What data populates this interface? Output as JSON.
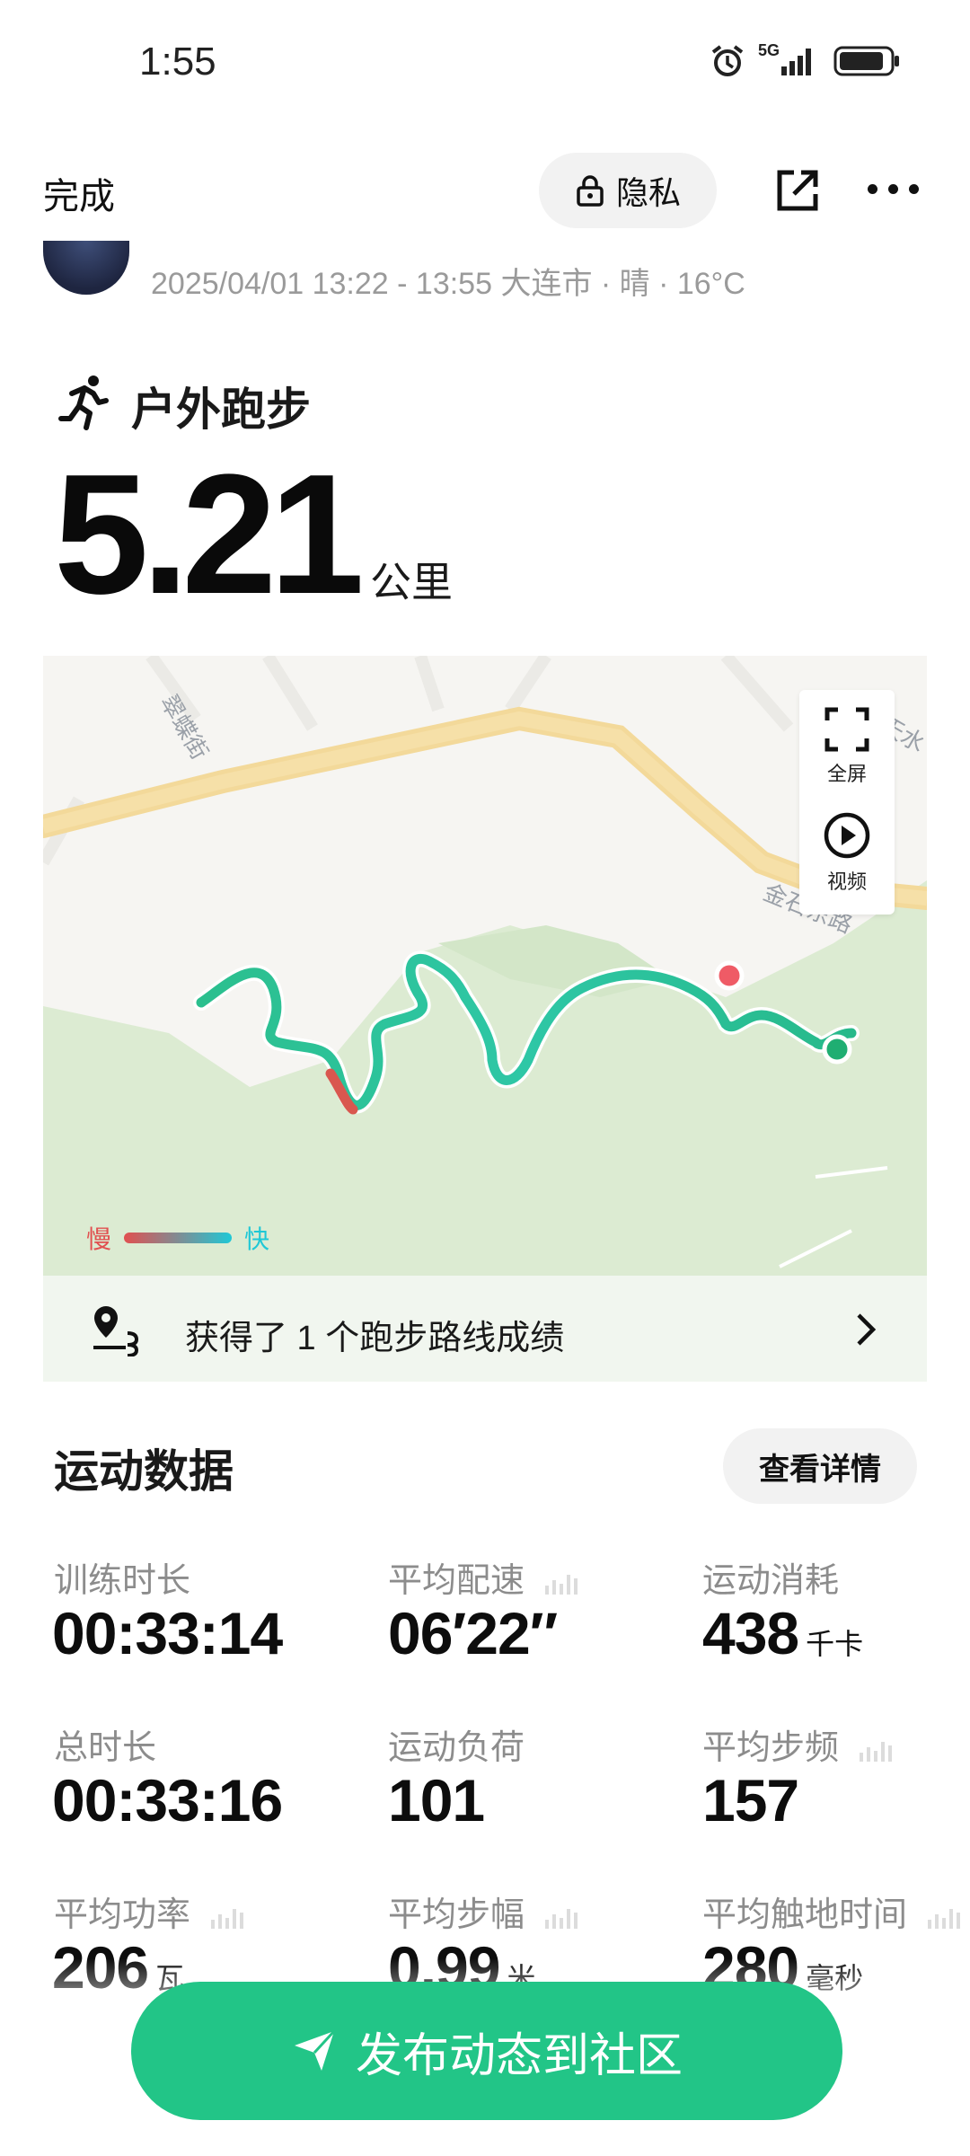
{
  "status_bar": {
    "time": "1:55",
    "network": "5G"
  },
  "nav": {
    "done_label": "完成",
    "privacy_label": "隐私"
  },
  "meta": {
    "datetime_location_weather": "2025/04/01 13:22 - 13:55 大连市 · 晴 · 16°C"
  },
  "activity": {
    "type_label": "户外跑步",
    "distance": "5.21",
    "distance_unit": "公里"
  },
  "map": {
    "street_label_1": "翠蝶街",
    "street_label_2": "金石东路",
    "street_label_3": "天水",
    "fullscreen_label": "全屏",
    "video_label": "视频",
    "legend_slow": "慢",
    "legend_fast": "快",
    "colors": {
      "slow": "#e15050",
      "fast": "#1fc8d6",
      "route": "#2bbf8e",
      "start_dot": "#ef5b66",
      "end_dot": "#1fae72"
    }
  },
  "achievement": {
    "text": "获得了 1 个跑步路线成绩"
  },
  "sports_data": {
    "title": "运动数据",
    "detail_button": "查看详情",
    "stats": [
      {
        "label": "训练时长",
        "value": "00:33:14",
        "unit": ""
      },
      {
        "label": "平均配速",
        "value": "06′22″",
        "unit": ""
      },
      {
        "label": "运动消耗",
        "value": "438",
        "unit": "千卡"
      },
      {
        "label": "总时长",
        "value": "00:33:16",
        "unit": ""
      },
      {
        "label": "运动负荷",
        "value": "101",
        "unit": ""
      },
      {
        "label": "平均步频",
        "value": "157",
        "unit": ""
      },
      {
        "label": "平均功率",
        "value": "206",
        "unit": "瓦"
      },
      {
        "label": "平均步幅",
        "value": "0.99",
        "unit": "米"
      },
      {
        "label": "平均触地时间",
        "value": "280",
        "unit": "毫秒"
      }
    ]
  },
  "publish_button": "发布动态到社区",
  "accent_color": "#22c587"
}
